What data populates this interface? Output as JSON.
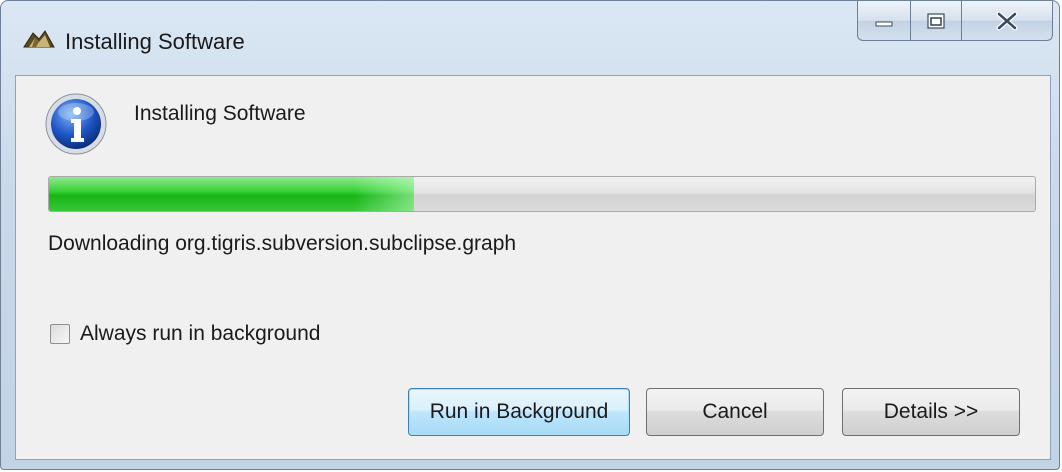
{
  "window": {
    "title": "Installing Software",
    "controls": {
      "minimize_icon": "minimize-icon",
      "maximize_icon": "maximize-icon",
      "close_icon": "close-icon"
    }
  },
  "dialog": {
    "header": "Installing Software",
    "info_icon": "info-icon",
    "progress_fraction": 0.37,
    "status": "Downloading org.tigris.subversion.subclipse.graph",
    "always_background": {
      "label": "Always run in background",
      "checked": false
    },
    "buttons": {
      "run_background": "Run in Background",
      "cancel": "Cancel",
      "details": "Details >>"
    }
  },
  "colors": {
    "progress_green": "#16b516",
    "title_bar": "#cad9ea",
    "dialog_bg": "#f0f0f0",
    "primary_button": "#bee6fd"
  }
}
